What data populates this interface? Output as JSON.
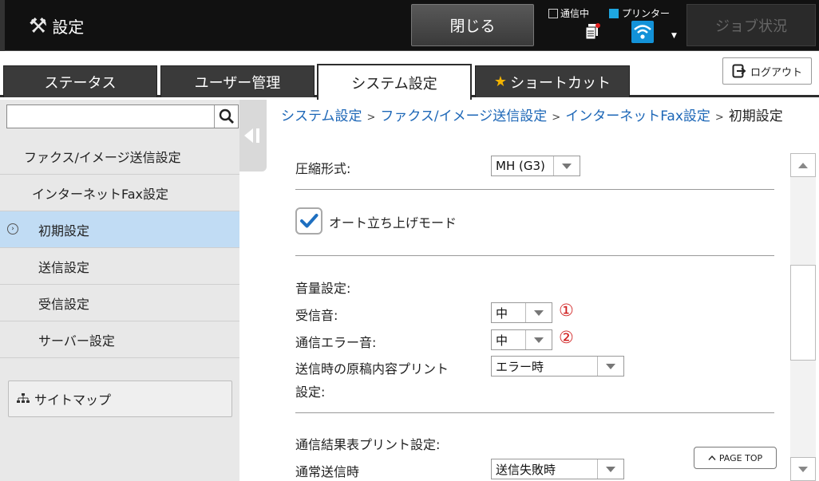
{
  "topbar": {
    "title": "設定",
    "title_icon": "tools-icon",
    "close_label": "閉じる",
    "comm_label": "通信中",
    "printer_label": "プリンター",
    "job_status_label": "ジョブ状況"
  },
  "tabs": [
    {
      "label": "ステータス",
      "active": false
    },
    {
      "label": "ユーザー管理",
      "active": false
    },
    {
      "label": "システム設定",
      "active": true
    },
    {
      "label": "ショートカット",
      "active": false,
      "icon": "star-icon"
    }
  ],
  "logout_label": "ログアウト",
  "search": {
    "value": "",
    "placeholder": ""
  },
  "sidebar": {
    "items": [
      {
        "label": "ファクス/イメージ送信設定",
        "level": 1,
        "selected": false
      },
      {
        "label": "インターネットFax設定",
        "level": 2,
        "selected": false
      },
      {
        "label": "初期設定",
        "level": 3,
        "selected": true
      },
      {
        "label": "送信設定",
        "level": 3,
        "selected": false
      },
      {
        "label": "受信設定",
        "level": 3,
        "selected": false
      },
      {
        "label": "サーバー設定",
        "level": 3,
        "selected": false
      }
    ],
    "sitemap_label": "サイトマップ"
  },
  "breadcrumb": {
    "items": [
      "システム設定",
      "ファクス/イメージ送信設定",
      "インターネットFax設定",
      "初期設定"
    ],
    "separator": ">"
  },
  "settings": {
    "compression_label": "圧縮形式:",
    "compression_value": "MH (G3)",
    "auto_start_label": "オート立ち上げモード",
    "auto_start_checked": true,
    "volume_heading": "音量設定:",
    "receive_tone_label": "受信音:",
    "receive_tone_value": "中",
    "error_tone_label": "通信エラー音:",
    "error_tone_value": "中",
    "original_print_label_1": "送信時の原稿内容プリント",
    "original_print_label_2": "設定:",
    "original_print_value": "エラー時",
    "report_heading": "通信結果表プリント設定:",
    "normal_send_label": "通常送信時",
    "normal_send_value": "送信失敗時"
  },
  "callouts": {
    "one": "①",
    "two": "②"
  },
  "page_top_label": "PAGE TOP",
  "colors": {
    "link": "#1d67b7",
    "selected_row": "#c1dcf4",
    "printer_status": "#1ea6e0",
    "callout": "#d01f1f",
    "star": "#f4b400"
  }
}
